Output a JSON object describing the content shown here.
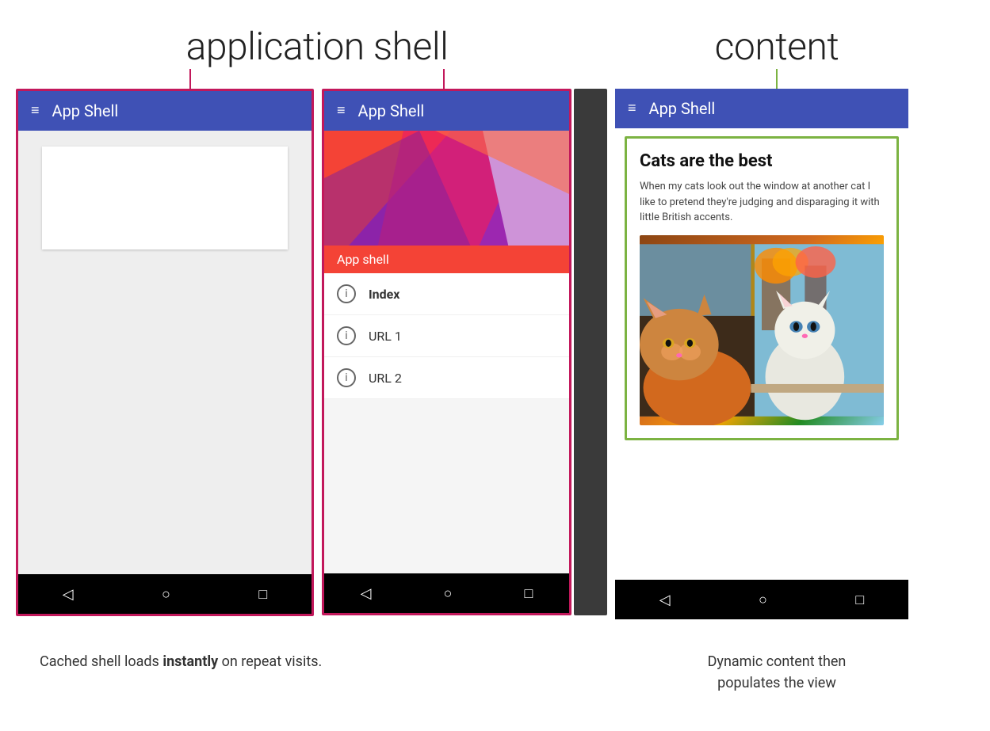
{
  "labels": {
    "application_shell": "application shell",
    "content": "content"
  },
  "left_phone": {
    "app_bar_title": "App Shell",
    "hamburger": "≡"
  },
  "middle_phone": {
    "app_bar_title": "App Shell",
    "hamburger": "≡",
    "overlay_label": "App shell",
    "menu_items": [
      {
        "text": "Index",
        "bold": true
      },
      {
        "text": "URL 1",
        "bold": false
      },
      {
        "text": "URL 2",
        "bold": false
      }
    ]
  },
  "right_phone": {
    "app_bar_title": "App Shell",
    "hamburger": "≡",
    "content_title": "Cats are the best",
    "content_text": "When my cats look out the window at another cat I like to pretend they're judging and disparaging it with little British accents."
  },
  "nav_bar": {
    "back_icon": "◁",
    "home_icon": "○",
    "recents_icon": "□"
  },
  "captions": {
    "left": "Cached shell loads ",
    "left_bold": "instantly",
    "left_suffix": " on repeat visits.",
    "right_line1": "Dynamic content then",
    "right_line2": "populates the view"
  }
}
